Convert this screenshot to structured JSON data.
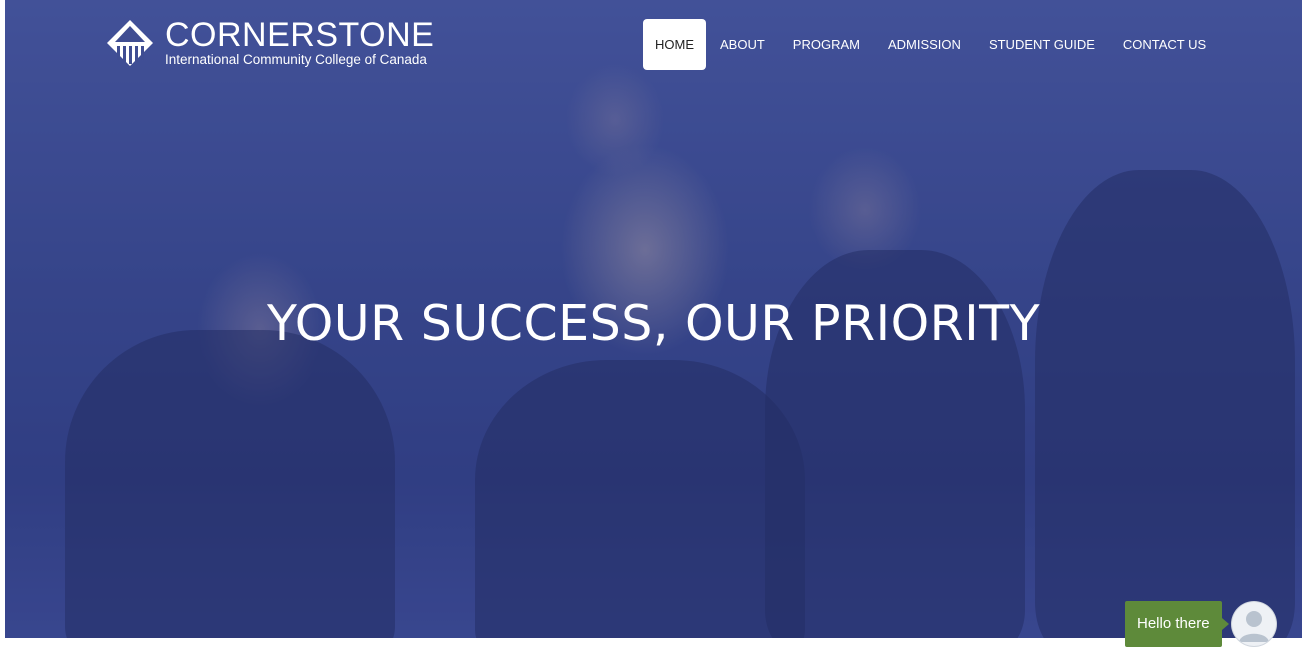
{
  "brand": {
    "name": "CORNERSTONE",
    "tagline": "International Community College of Canada"
  },
  "nav": {
    "items": [
      {
        "label": "HOME",
        "active": true
      },
      {
        "label": "ABOUT",
        "active": false
      },
      {
        "label": "PROGRAM",
        "active": false
      },
      {
        "label": "ADMISSION",
        "active": false
      },
      {
        "label": "STUDENT GUIDE",
        "active": false
      },
      {
        "label": "CONTACT US",
        "active": false
      }
    ]
  },
  "hero": {
    "title": "YOUR SUCCESS, OUR PRIORITY"
  },
  "chat": {
    "greeting": "Hello there",
    "avatar_icon": "user-avatar-icon"
  },
  "colors": {
    "overlay": "#3a4a8f",
    "chat_green": "#5e8a3a",
    "nav_active_bg": "#ffffff"
  }
}
